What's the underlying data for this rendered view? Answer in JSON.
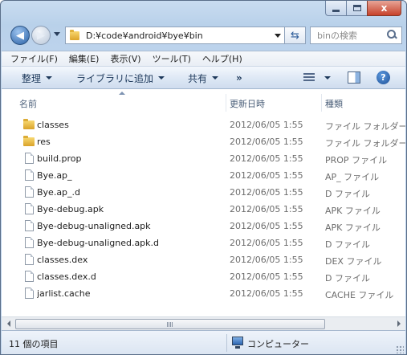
{
  "window": {
    "caption_buttons": {
      "minimize": "minimize-icon",
      "maximize": "maximize-icon",
      "close": "close-icon",
      "close_glyph": "x"
    }
  },
  "navigation": {
    "back_glyph": "◀",
    "forward_glyph": "▶",
    "address_path": "D:¥code¥android¥bye¥bin",
    "refresh_glyph": "⇆",
    "search_placeholder": "binの検索"
  },
  "menubar": {
    "items": [
      "ファイル(F)",
      "編集(E)",
      "表示(V)",
      "ツール(T)",
      "ヘルプ(H)"
    ]
  },
  "commandbar": {
    "organize": "整理",
    "add_to_library": "ライブラリに追加",
    "share": "共有",
    "more": "»",
    "help_glyph": "?"
  },
  "columns": {
    "name": "名前",
    "date_modified": "更新日時",
    "type": "種類"
  },
  "files": [
    {
      "name": "classes",
      "date": "2012/06/05 1:55",
      "type": "ファイル フォルダー",
      "icon": "folder-icon"
    },
    {
      "name": "res",
      "date": "2012/06/05 1:55",
      "type": "ファイル フォルダー",
      "icon": "folder-icon"
    },
    {
      "name": "build.prop",
      "date": "2012/06/05 1:55",
      "type": "PROP ファイル",
      "icon": "file-icon"
    },
    {
      "name": "Bye.ap_",
      "date": "2012/06/05 1:55",
      "type": "AP_ ファイル",
      "icon": "file-icon"
    },
    {
      "name": "Bye.ap_.d",
      "date": "2012/06/05 1:55",
      "type": "D ファイル",
      "icon": "file-icon"
    },
    {
      "name": "Bye-debug.apk",
      "date": "2012/06/05 1:55",
      "type": "APK ファイル",
      "icon": "file-icon"
    },
    {
      "name": "Bye-debug-unaligned.apk",
      "date": "2012/06/05 1:55",
      "type": "APK ファイル",
      "icon": "file-icon"
    },
    {
      "name": "Bye-debug-unaligned.apk.d",
      "date": "2012/06/05 1:55",
      "type": "D ファイル",
      "icon": "file-icon"
    },
    {
      "name": "classes.dex",
      "date": "2012/06/05 1:55",
      "type": "DEX ファイル",
      "icon": "file-icon"
    },
    {
      "name": "classes.dex.d",
      "date": "2012/06/05 1:55",
      "type": "D ファイル",
      "icon": "file-icon"
    },
    {
      "name": "jarlist.cache",
      "date": "2012/06/05 1:55",
      "type": "CACHE ファイル",
      "icon": "file-icon"
    }
  ],
  "statusbar": {
    "item_count": "11 個の項目",
    "location": "コンピューター"
  },
  "colors": {
    "window_frame": "#b9d1ea",
    "command_text": "#1e395b",
    "secondary_text": "#6d6d6d"
  }
}
